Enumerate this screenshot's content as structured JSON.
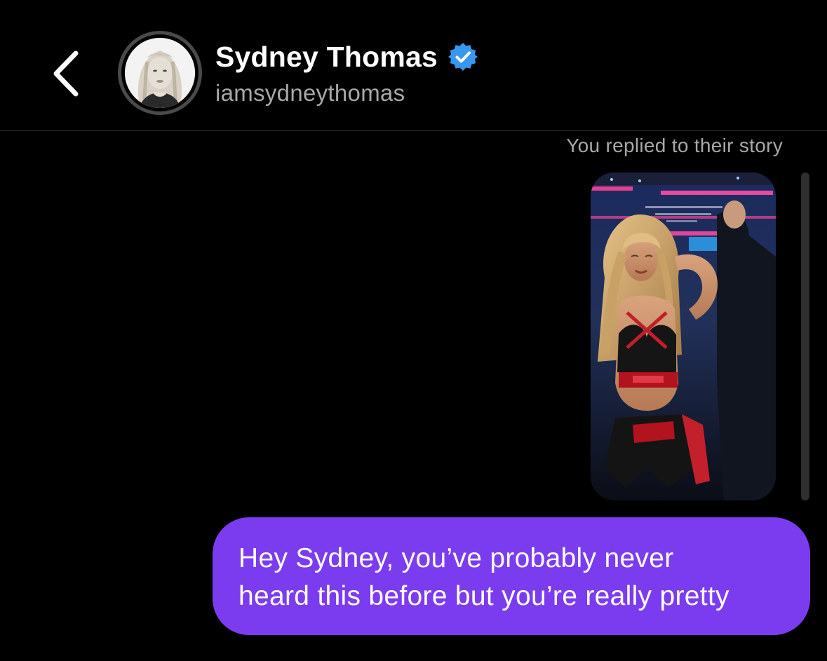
{
  "header": {
    "name": "Sydney Thomas",
    "handle": "iamsydneythomas",
    "verified": true,
    "icons": {
      "back": "chevron-left-icon",
      "verified": "verified-badge-icon"
    }
  },
  "conversation": {
    "story_reply_note": "You replied to their story",
    "message_lines": [
      "Hey Sydney, you’ve probably never",
      "heard this before but you’re really pretty"
    ]
  },
  "colors": {
    "background": "#000000",
    "bubble": "#7b3cf0",
    "verified": "#3897f0",
    "secondary_text": "#a8a8a8"
  }
}
